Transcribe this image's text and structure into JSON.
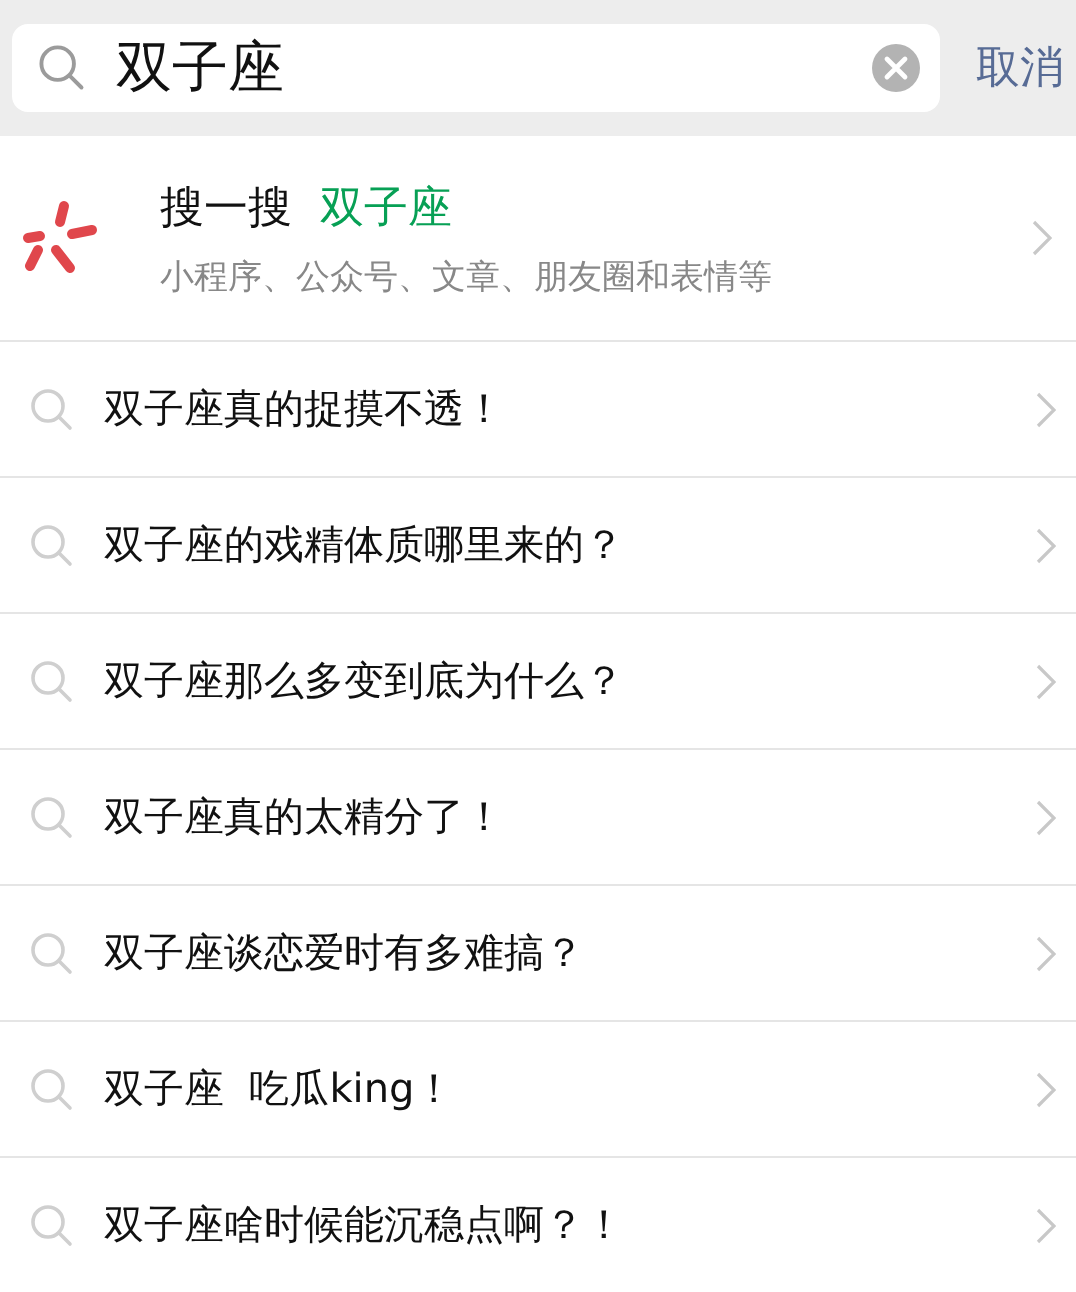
{
  "search": {
    "value": "双子座",
    "cancel": "取消"
  },
  "search_one": {
    "label": "搜一搜",
    "keyword": "双子座",
    "subtitle": "小程序、公众号、文章、朋友圈和表情等"
  },
  "suggestions": [
    {
      "text": "双子座真的捉摸不透！"
    },
    {
      "text": "双子座的戏精体质哪里来的？"
    },
    {
      "text": "双子座那么多变到底为什么？"
    },
    {
      "text": "双子座真的太精分了！"
    },
    {
      "text": "双子座谈恋爱时有多难搞？"
    },
    {
      "text": "双子座  吃瓜king！"
    },
    {
      "text": "双子座啥时候能沉稳点啊？！"
    }
  ]
}
